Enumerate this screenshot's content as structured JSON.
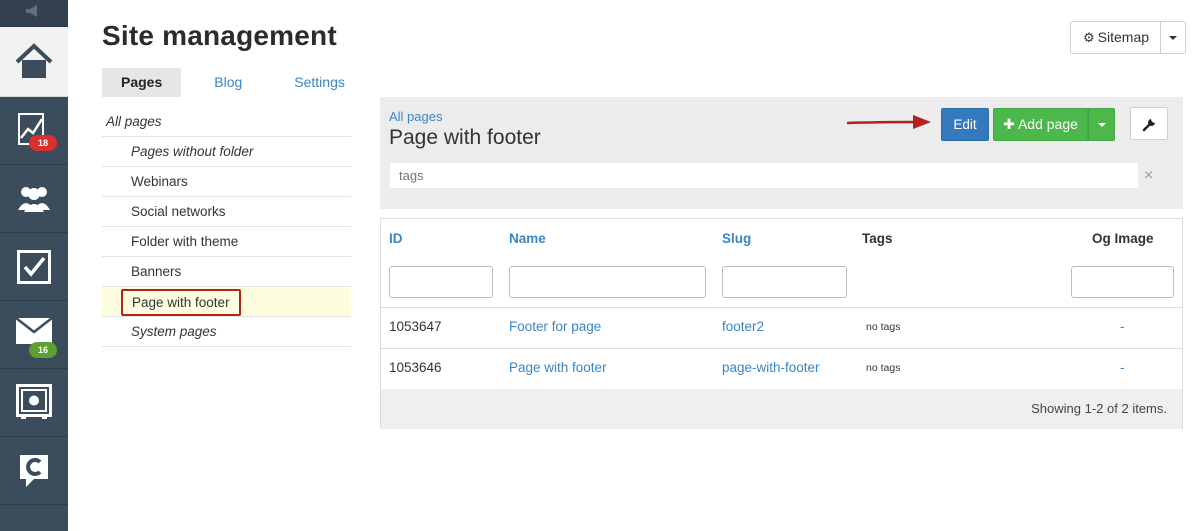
{
  "header": {
    "title": "Site management",
    "tabs": [
      {
        "label": "Pages",
        "active": true
      },
      {
        "label": "Blog",
        "active": false
      },
      {
        "label": "Settings",
        "active": false
      }
    ],
    "sitemap_label": "Sitemap"
  },
  "sidebar": {
    "items": [
      {
        "icon": "home-icon"
      },
      {
        "icon": "chart-icon",
        "badge": "18",
        "badge_color": "#d9302c"
      },
      {
        "icon": "users-icon"
      },
      {
        "icon": "checkbox-icon"
      },
      {
        "icon": "mail-icon",
        "badge": "16",
        "badge_color": "#5aa12f"
      },
      {
        "icon": "safe-icon"
      },
      {
        "icon": "logo-c-icon"
      }
    ]
  },
  "folders": {
    "root": "All pages",
    "items": [
      {
        "label": "Pages without folder",
        "italic": true
      },
      {
        "label": "Webinars"
      },
      {
        "label": "Social networks"
      },
      {
        "label": "Folder with theme"
      },
      {
        "label": "Banners"
      },
      {
        "label": "Page with footer",
        "selected": true
      },
      {
        "label": "System pages",
        "italic": true
      }
    ]
  },
  "panel": {
    "breadcrumb": "All pages",
    "title": "Page with footer",
    "tags_placeholder": "tags",
    "tags_clear": "×",
    "edit_label": "Edit",
    "add_page_label": "Add page"
  },
  "table": {
    "columns": [
      "ID",
      "Name",
      "Slug",
      "Tags",
      "Og Image"
    ],
    "rows": [
      {
        "id": "1053647",
        "name": "Footer for page",
        "slug": "footer2",
        "tags": "no tags",
        "og_image": "-"
      },
      {
        "id": "1053646",
        "name": "Page with footer",
        "slug": "page-with-footer",
        "tags": "no tags",
        "og_image": "-"
      }
    ],
    "summary": "Showing 1-2 of 2 items."
  },
  "colors": {
    "sidebar_bg": "#3b4c5c",
    "link": "#3a85c6",
    "edit_button": "#3479bd",
    "add_button": "#4cb84c",
    "highlight_border": "#b3231b"
  }
}
